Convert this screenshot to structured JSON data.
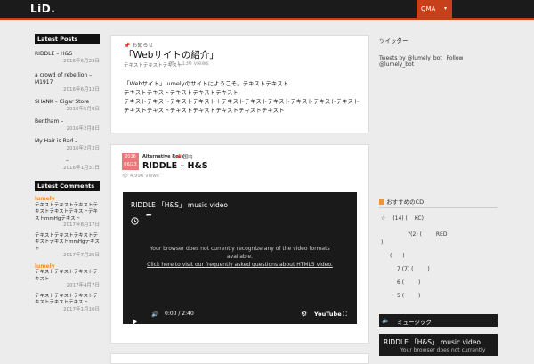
{
  "header": {
    "logo": "LiD.",
    "nav_label": "QMA",
    "nav_caret": "▾"
  },
  "left_sidebar": {
    "latest_posts_heading": "Latest Posts",
    "posts": [
      {
        "title": "RIDDLE – H&S",
        "date": "2016年6月23日"
      },
      {
        "title": "a crowd of rebellion – M1917",
        "date": "2016年6月13日"
      },
      {
        "title": "SHANK – Cigar Store",
        "date": "2016年5月9日"
      },
      {
        "title": "Bentham –",
        "date": "2016年2月8日"
      },
      {
        "title": "My Hair is Bad –",
        "date": "2016年2月3日"
      },
      {
        "title": "–",
        "date": "2016年1月31日"
      }
    ],
    "latest_comments_heading": "Latest Comments",
    "comments": [
      {
        "author": "lumely",
        "text": "テキストテキストテキストテキストテキストテキストテキストmmHgテキスト",
        "date": "2017年8月17日"
      },
      {
        "author": "",
        "text": "テキストテキストテキストテキストテキストmmHgテキスト",
        "date": "2017年7月25日"
      },
      {
        "author": "lumely",
        "text": "テキストテキストテキストテキスト",
        "date": "2017年4月7日"
      },
      {
        "author": "",
        "text": "テキストテキストテキストテキストテキストテキスト",
        "date": "2017年1月10日"
      }
    ]
  },
  "posts": [
    {
      "category": "お知らせ",
      "title": "「Webサイトの紹介」",
      "meta_left": "テキストテキストテキスト",
      "views": "1,130 views",
      "body_line1": "「Webサイト」lumelyのサイトにようこそ。テキストテキスト",
      "body_line2": "テキストテキストテキストテキストテキスト",
      "body_line3": "テキストテキストテキストテキスト＋テキストテキストテキストテキストテキストテキストテキストテキストテキストテキストテキストテキストテキスト"
    },
    {
      "date_badge_top": "2016",
      "date_badge_bottom": "06/23",
      "genre": "Alternative Rock",
      "sub_category": "国内",
      "title": "RIDDLE – H&S",
      "views": "4,996 views",
      "video": {
        "title": "RIDDLE 「H&S」 music video",
        "message_line1": "Your browser does not currently recognize any of the video formats",
        "message_line2": "available.",
        "link_text": "Click here to visit our frequently asked questions about HTML5 video.",
        "time": "0:00 / 2:40",
        "brand": "YouTube"
      }
    }
  ],
  "right_sidebar": {
    "heading1": "ツイッター",
    "tweets_by": "Tweets by @lumely_bot",
    "follow": "Follow @lumely_bot",
    "cd_heading": "おすすめのCD",
    "cd_items": [
      {
        "rank": "☆",
        "count": "(14) (",
        "label": "KC)"
      },
      {
        "rank": "",
        "count": "?(2) (",
        "label": "RED"
      },
      {
        "rank": ")",
        "count": "",
        "label": ""
      },
      {
        "rank": "(",
        "count": ")",
        "label": ""
      },
      {
        "rank": "7 (7) (",
        "count": ")",
        "label": ""
      },
      {
        "rank": "6 (",
        "count": ")",
        "label": ""
      },
      {
        "rank": "5 (",
        "count": ")",
        "label": ""
      }
    ],
    "music_heading": "ミュージック",
    "mini_video_title": "RIDDLE 「H&S」 music video",
    "mini_video_msg": "Your browser does not currently"
  },
  "colors": {
    "accent": "#c8401a",
    "dark": "#1b1b1b",
    "lumely_orange": "#e8963a"
  }
}
